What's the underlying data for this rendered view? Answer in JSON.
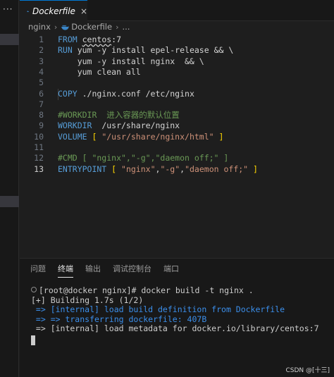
{
  "tab": {
    "title": "Dockerfile",
    "close": "×"
  },
  "sidebar": {
    "overflow": "···"
  },
  "breadcrumb": {
    "folder": "nginx",
    "sep": "›",
    "file": "Dockerfile",
    "more": "..."
  },
  "editor": {
    "lines": [
      {
        "n": "1",
        "tokens": [
          {
            "t": "FROM ",
            "c": "kw"
          },
          {
            "t": "centos",
            "c": "plain ul"
          },
          {
            "t": ":7",
            "c": "plain"
          }
        ]
      },
      {
        "n": "2",
        "tokens": [
          {
            "t": "RUN ",
            "c": "kw"
          },
          {
            "t": "yum -y install epel-release && \\",
            "c": "plain"
          }
        ]
      },
      {
        "n": "3",
        "tokens": [
          {
            "t": "    yum -y install nginx  && \\",
            "c": "plain"
          }
        ]
      },
      {
        "n": "4",
        "tokens": [
          {
            "t": "    yum clean all",
            "c": "plain"
          }
        ]
      },
      {
        "n": "5",
        "tokens": []
      },
      {
        "n": "6",
        "tokens": [
          {
            "t": "COPY ",
            "c": "kw"
          },
          {
            "t": "./nginx.conf /etc/nginx",
            "c": "plain"
          }
        ]
      },
      {
        "n": "7",
        "tokens": []
      },
      {
        "n": "8",
        "tokens": [
          {
            "t": "#WORKDIR  进入容器的默认位置",
            "c": "cmt"
          }
        ]
      },
      {
        "n": "9",
        "tokens": [
          {
            "t": "WORKDIR ",
            "c": "kw"
          },
          {
            "t": " /usr/share/nginx",
            "c": "plain"
          }
        ]
      },
      {
        "n": "10",
        "tokens": [
          {
            "t": "VOLUME ",
            "c": "kw"
          },
          {
            "t": "[ ",
            "c": "brk"
          },
          {
            "t": "\"/usr/share/nginx/html\"",
            "c": "str"
          },
          {
            "t": " ]",
            "c": "brk"
          }
        ]
      },
      {
        "n": "11",
        "tokens": []
      },
      {
        "n": "12",
        "tokens": [
          {
            "t": "#CMD [ \"nginx\",\"-g\",\"daemon off;\" ]",
            "c": "cmt"
          }
        ]
      },
      {
        "n": "13",
        "active": true,
        "tokens": [
          {
            "t": "ENTRYPOINT ",
            "c": "kw"
          },
          {
            "t": "[ ",
            "c": "brk"
          },
          {
            "t": "\"nginx\"",
            "c": "str"
          },
          {
            "t": ",",
            "c": "plain"
          },
          {
            "t": "\"-g\"",
            "c": "str"
          },
          {
            "t": ",",
            "c": "plain"
          },
          {
            "t": "\"daemon off;\"",
            "c": "str"
          },
          {
            "t": " ]",
            "c": "brk"
          }
        ]
      }
    ]
  },
  "panel": {
    "tabs": [
      "问题",
      "终端",
      "输出",
      "调试控制台",
      "端口"
    ],
    "active_tab": 1
  },
  "terminal": {
    "prompt": "[root@docker nginx]# docker build -t nginx .",
    "lines": [
      {
        "text": "[+] Building 1.7s (1/2)",
        "style": "plain"
      },
      {
        "text": " => [internal] load build definition from Dockerfile",
        "style": "blue"
      },
      {
        "text": " => => transferring dockerfile: 407B",
        "style": "blue"
      },
      {
        "text": " => [internal] load metadata for docker.io/library/centos:7",
        "style": "plain"
      }
    ]
  },
  "watermark": "CSDN @[十三]",
  "colors": {
    "accent": "#0078d4",
    "keyword": "#569cd6",
    "string": "#ce9178",
    "comment": "#6a9955",
    "terminal_blue": "#3b8eea"
  }
}
